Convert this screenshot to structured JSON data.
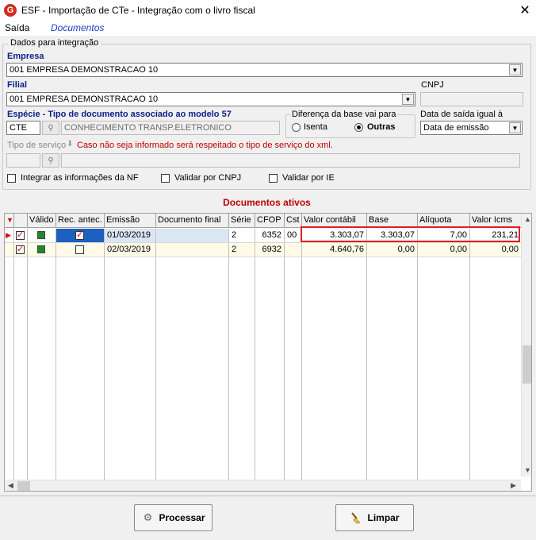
{
  "window": {
    "title": "ESF - Importação de CTe - Integração com o livro fiscal",
    "close_glyph": "✕",
    "app_glyph": "G"
  },
  "menu": {
    "items": [
      "Saída",
      "Documentos"
    ]
  },
  "group": {
    "caption": "Dados para integração",
    "empresa": {
      "label": "Empresa",
      "value": "001 EMPRESA DEMONSTRACAO 10"
    },
    "filial": {
      "label": "Filial",
      "value": "001 EMPRESA DEMONSTRACAO 10"
    },
    "cnpj": {
      "label": "CNPJ",
      "value": ""
    },
    "especie": {
      "label": "Espécie - Tipo de documento associado ao modelo 57",
      "code": "CTE",
      "description": "CONHECIMENTO TRANSP.ELETRONICO"
    },
    "diferenca": {
      "label": "Diferença da base vai para",
      "options": [
        "Isenta",
        "Outras"
      ],
      "selected": "Outras"
    },
    "data_saida": {
      "label": "Data de saída igual à",
      "value": "Data de emissão"
    },
    "tipo_servico": {
      "label": "Tipo de serviço",
      "warning": "Caso não seja informado será respeitado o tipo de serviço do xml.",
      "code": "",
      "description": ""
    },
    "checks": [
      {
        "label": "Integrar as informações da NF",
        "checked": false
      },
      {
        "label": "Validar por CNPJ",
        "checked": false
      },
      {
        "label": "Validar por IE",
        "checked": false
      }
    ]
  },
  "grid": {
    "title": "Documentos ativos",
    "columns": [
      "",
      "",
      "Válido",
      "Rec. antec.",
      "Emissão",
      "Documento final",
      "Série",
      "CFOP",
      "Cst",
      "Valor contábil",
      "Base",
      "Alíquota",
      "Valor Icms"
    ],
    "rows": [
      {
        "emissao": "01/03/2019",
        "doc_final": "",
        "serie": "2",
        "cfop": "6352",
        "cst": "00",
        "valor_contabil": "3.303,07",
        "base": "3.303,07",
        "aliquota": "7,00",
        "valor_icms": "231,21",
        "rec_antec": true
      },
      {
        "emissao": "02/03/2019",
        "doc_final": "",
        "serie": "2",
        "cfop": "6932",
        "cst": "",
        "valor_contabil": "4.640,76",
        "base": "0,00",
        "aliquota": "0,00",
        "valor_icms": "0,00",
        "rec_antec": false
      }
    ]
  },
  "buttons": {
    "processar": "Processar",
    "limpar": "Limpar"
  },
  "colors": {
    "accent_red": "#e02020",
    "label_blue": "#0d1f8a",
    "menu_blue": "#1e3ccd",
    "warning_red": "#c00000"
  }
}
